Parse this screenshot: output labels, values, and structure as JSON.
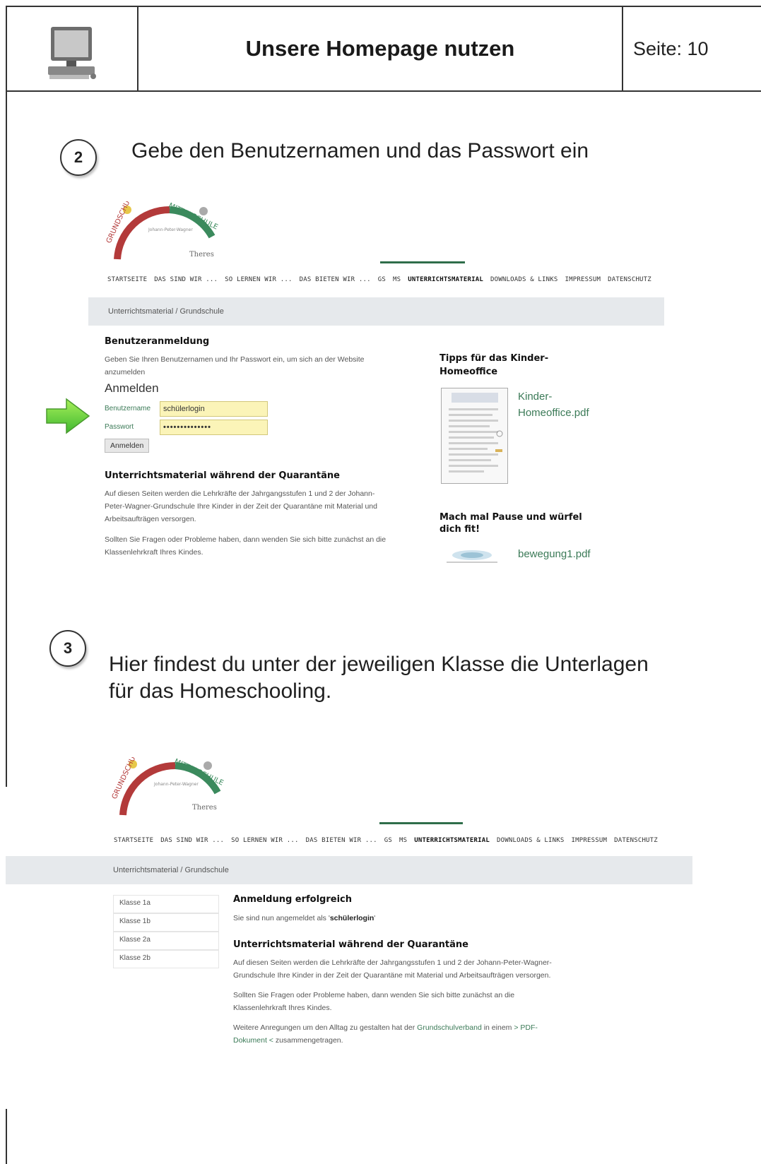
{
  "header": {
    "icon": "computer-icon",
    "title": "Unsere Homepage nutzen",
    "page": "Seite: 10"
  },
  "step2": {
    "number": "2",
    "text": "Gebe den Benutzernamen und das Passwort ein"
  },
  "step3": {
    "number": "3",
    "line1": "Hier findest du unter der jeweiligen Klasse die Unterlagen",
    "line2": "für das Homeschooling."
  },
  "logo": {
    "left_arc": "GRUNDSCHULE",
    "right_arc": "MITTELSCHULE",
    "center": "Johann-Peter-Wagner",
    "place": "Theres"
  },
  "nav": {
    "items": [
      "STARTSEITE",
      "DAS SIND WIR ...",
      "SO LERNEN WIR ...",
      "DAS BIETEN WIR ...",
      "GS",
      "MS",
      "UNTERRICHTSMATERIAL",
      "DOWNLOADS & LINKS",
      "IMPRESSUM",
      "DATENSCHUTZ"
    ],
    "active_index": 6,
    "accent_color": "#2f6e4a"
  },
  "breadcrumb": "Unterrichtsmaterial / Grundschule",
  "login_page": {
    "heading": "Benutzeranmeldung",
    "intro_line1": "Geben Sie Ihren Benutzernamen und Ihr Passwort ein, um sich an der Website",
    "intro_line2": "anzumelden",
    "form_title": "Anmelden",
    "username_label": "Benutzername",
    "username_value": "schülerlogin",
    "password_label": "Passwort",
    "password_value": "••••••••••••••",
    "submit_label": "Anmelden",
    "arrow_icon": "green-arrow-icon",
    "material_heading": "Unterrichtsmaterial während der Quarantäne",
    "material_lines": [
      "Auf diesen Seiten werden die Lehrkräfte der Jahrgangsstufen 1 und 2 der Johann-",
      "Peter-Wagner-Grundschule Ihre Kinder in der Zeit der Quarantäne mit Material und",
      "Arbeitsaufträgen versorgen."
    ],
    "questions_lines": [
      "Sollten Sie Fragen oder Probleme haben, dann wenden Sie sich bitte zunächst an die",
      "Klassenlehrkraft Ihres Kindes."
    ],
    "sidebar": {
      "tips_heading_line1": "Tipps für das Kinder-",
      "tips_heading_line2": "Homeoffice",
      "tips_link_line1": "Kinder-",
      "tips_link_line2": "Homeoffice.pdf",
      "pause_heading_line1": "Mach mal Pause und würfel",
      "pause_heading_line2": "dich fit!",
      "pause_link": "bewegung1.pdf"
    }
  },
  "success_page": {
    "classes": [
      "Klasse 1a",
      "Klasse 1b",
      "Klasse 2a",
      "Klasse 2b"
    ],
    "heading": "Anmeldung erfolgreich",
    "logged_in_prefix": "Sie sind nun angemeldet als '",
    "logged_in_user": "schülerlogin",
    "logged_in_suffix": "'",
    "material_heading": "Unterrichtsmaterial während der Quarantäne",
    "material_lines": [
      "Auf diesen Seiten werden die Lehrkräfte der Jahrgangsstufen 1 und 2 der Johann-Peter-Wagner-",
      "Grundschule Ihre Kinder in der Zeit der Quarantäne mit Material und Arbeitsaufträgen versorgen."
    ],
    "questions_lines": [
      "Sollten Sie Fragen oder Probleme haben, dann wenden Sie sich bitte zunächst an die",
      "Klassenlehrkraft Ihres Kindes."
    ],
    "more_prefix": "Weitere Anregungen um den Alltag zu gestalten hat der ",
    "more_link1": "Grundschulverband",
    "more_middle": " in einem ",
    "more_link2": "> PDF-",
    "more_link3": "Dokument <",
    "more_suffix": " zusammengetragen."
  }
}
